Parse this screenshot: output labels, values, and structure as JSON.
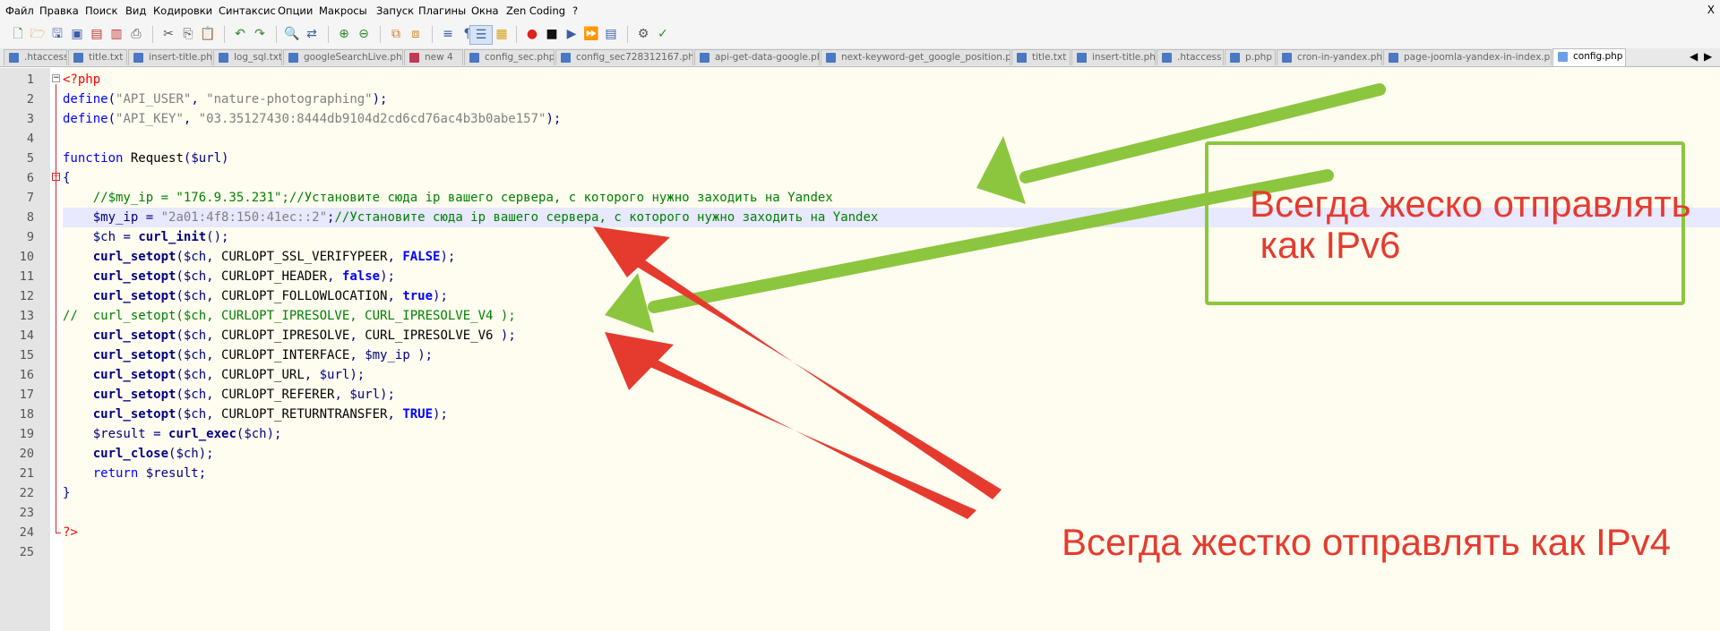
{
  "menu": [
    "Файл",
    "Правка",
    "Поиск",
    "Вид",
    "Кодировки",
    "Синтаксис",
    "Опции",
    "Макросы",
    "Запуск",
    "Плагины",
    "Окна",
    "Zen Coding",
    "?"
  ],
  "menu_close": "X",
  "tabs": [
    {
      "label": ".htaccess",
      "type": "normal"
    },
    {
      "label": "title.txt",
      "type": "normal"
    },
    {
      "label": "insert-title.php",
      "type": "normal"
    },
    {
      "label": "log_sql.txt",
      "type": "normal"
    },
    {
      "label": "googleSearchLive.php",
      "type": "normal"
    },
    {
      "label": "new 4",
      "type": "modified"
    },
    {
      "label": "config_sec.php",
      "type": "normal"
    },
    {
      "label": "config_sec728312167.php",
      "type": "normal"
    },
    {
      "label": "api-get-data-google.php",
      "type": "normal"
    },
    {
      "label": "next-keyword-get_google_position.php",
      "type": "normal"
    },
    {
      "label": "title.txt",
      "type": "normal"
    },
    {
      "label": "insert-title.php",
      "type": "normal"
    },
    {
      "label": ".htaccess",
      "type": "normal"
    },
    {
      "label": "p.php",
      "type": "normal"
    },
    {
      "label": "cron-in-yandex.php",
      "type": "normal"
    },
    {
      "label": "page-joomla-yandex-in-index.php",
      "type": "normal"
    },
    {
      "label": "config.php",
      "type": "active"
    }
  ],
  "tab_nav": {
    "prev": "◀",
    "next": "▶"
  },
  "line_numbers": [
    "1",
    "2",
    "3",
    "4",
    "5",
    "6",
    "7",
    "8",
    "9",
    "10",
    "11",
    "12",
    "13",
    "14",
    "15",
    "16",
    "17",
    "18",
    "19",
    "20",
    "21",
    "22",
    "23",
    "24",
    "25"
  ],
  "current_line": 8,
  "code_lines": [
    [
      [
        "tag",
        "<?php"
      ]
    ],
    [
      [
        "kw",
        "define"
      ],
      [
        "pn",
        "("
      ],
      [
        "str",
        "\"API_USER\""
      ],
      [
        "pn",
        ", "
      ],
      [
        "str",
        "\"nature-photographing\""
      ],
      [
        "pn",
        ");"
      ]
    ],
    [
      [
        "kw",
        "define"
      ],
      [
        "pn",
        "("
      ],
      [
        "str",
        "\"API_KEY\""
      ],
      [
        "pn",
        ", "
      ],
      [
        "str",
        "\"03.35127430:8444db9104d2cd6cd76ac4b3b0abe157\""
      ],
      [
        "pn",
        ");"
      ]
    ],
    [],
    [
      [
        "kw",
        "function"
      ],
      [
        "pl",
        " Request"
      ],
      [
        "pn",
        "("
      ],
      [
        "var",
        "$url"
      ],
      [
        "pn",
        ")"
      ]
    ],
    [
      [
        "pn",
        "{"
      ]
    ],
    [
      [
        "pl",
        "    "
      ],
      [
        "cm",
        "//$my_ip = \"176.9.35.231\";//Установите сюда ip вашего сервера, с которого нужно заходить на Yandex"
      ]
    ],
    [
      [
        "pl",
        "    "
      ],
      [
        "var",
        "$my_ip"
      ],
      [
        "pn",
        " = "
      ],
      [
        "str",
        "\"2a01:4f8:150:41ec::2\""
      ],
      [
        "pn",
        ";"
      ],
      [
        "cm",
        "//Установите сюда ip вашего сервера, с которого нужно заходить на Yandex"
      ]
    ],
    [
      [
        "pl",
        "    "
      ],
      [
        "var",
        "$ch"
      ],
      [
        "pn",
        " = "
      ],
      [
        "fn",
        "curl_init"
      ],
      [
        "pn",
        "();"
      ]
    ],
    [
      [
        "pl",
        "    "
      ],
      [
        "fn",
        "curl_setopt"
      ],
      [
        "pn",
        "("
      ],
      [
        "var",
        "$ch"
      ],
      [
        "pn",
        ", "
      ],
      [
        "pl",
        "CURLOPT_SSL_VERIFYPEER"
      ],
      [
        "pn",
        ", "
      ],
      [
        "bool",
        "FALSE"
      ],
      [
        "pn",
        ");"
      ]
    ],
    [
      [
        "pl",
        "    "
      ],
      [
        "fn",
        "curl_setopt"
      ],
      [
        "pn",
        "("
      ],
      [
        "var",
        "$ch"
      ],
      [
        "pn",
        ", "
      ],
      [
        "pl",
        "CURLOPT_HEADER"
      ],
      [
        "pn",
        ", "
      ],
      [
        "bool",
        "false"
      ],
      [
        "pn",
        ");"
      ]
    ],
    [
      [
        "pl",
        "    "
      ],
      [
        "fn",
        "curl_setopt"
      ],
      [
        "pn",
        "("
      ],
      [
        "var",
        "$ch"
      ],
      [
        "pn",
        ", "
      ],
      [
        "pl",
        "CURLOPT_FOLLOWLOCATION"
      ],
      [
        "pn",
        ", "
      ],
      [
        "bool",
        "true"
      ],
      [
        "pn",
        ");"
      ]
    ],
    [
      [
        "cm",
        "//  curl_setopt($ch, CURLOPT_IPRESOLVE, CURL_IPRESOLVE_V4 );"
      ]
    ],
    [
      [
        "pl",
        "    "
      ],
      [
        "fn",
        "curl_setopt"
      ],
      [
        "pn",
        "("
      ],
      [
        "var",
        "$ch"
      ],
      [
        "pn",
        ", "
      ],
      [
        "pl",
        "CURLOPT_IPRESOLVE"
      ],
      [
        "pn",
        ", "
      ],
      [
        "pl",
        "CURL_IPRESOLVE_V6"
      ],
      [
        "pn",
        " );"
      ]
    ],
    [
      [
        "pl",
        "    "
      ],
      [
        "fn",
        "curl_setopt"
      ],
      [
        "pn",
        "("
      ],
      [
        "var",
        "$ch"
      ],
      [
        "pn",
        ", "
      ],
      [
        "pl",
        "CURLOPT_INTERFACE"
      ],
      [
        "pn",
        ", "
      ],
      [
        "var",
        "$my_ip"
      ],
      [
        "pn",
        " );"
      ]
    ],
    [
      [
        "pl",
        "    "
      ],
      [
        "fn",
        "curl_setopt"
      ],
      [
        "pn",
        "("
      ],
      [
        "var",
        "$ch"
      ],
      [
        "pn",
        ", "
      ],
      [
        "pl",
        "CURLOPT_URL"
      ],
      [
        "pn",
        ", "
      ],
      [
        "var",
        "$url"
      ],
      [
        "pn",
        ");"
      ]
    ],
    [
      [
        "pl",
        "    "
      ],
      [
        "fn",
        "curl_setopt"
      ],
      [
        "pn",
        "("
      ],
      [
        "var",
        "$ch"
      ],
      [
        "pn",
        ", "
      ],
      [
        "pl",
        "CURLOPT_REFERER"
      ],
      [
        "pn",
        ", "
      ],
      [
        "var",
        "$url"
      ],
      [
        "pn",
        ");"
      ]
    ],
    [
      [
        "pl",
        "    "
      ],
      [
        "fn",
        "curl_setopt"
      ],
      [
        "pn",
        "("
      ],
      [
        "var",
        "$ch"
      ],
      [
        "pn",
        ", "
      ],
      [
        "pl",
        "CURLOPT_RETURNTRANSFER"
      ],
      [
        "pn",
        ", "
      ],
      [
        "bool",
        "TRUE"
      ],
      [
        "pn",
        ");"
      ]
    ],
    [
      [
        "pl",
        "    "
      ],
      [
        "var",
        "$result"
      ],
      [
        "pn",
        " = "
      ],
      [
        "fn",
        "curl_exec"
      ],
      [
        "pn",
        "("
      ],
      [
        "var",
        "$ch"
      ],
      [
        "pn",
        ");"
      ]
    ],
    [
      [
        "pl",
        "    "
      ],
      [
        "fn",
        "curl_close"
      ],
      [
        "pn",
        "("
      ],
      [
        "var",
        "$ch"
      ],
      [
        "pn",
        ");"
      ]
    ],
    [
      [
        "pl",
        "    "
      ],
      [
        "kw",
        "return"
      ],
      [
        "pl",
        " "
      ],
      [
        "var",
        "$result"
      ],
      [
        "pn",
        ";"
      ]
    ],
    [
      [
        "pn",
        "}"
      ]
    ],
    [],
    [
      [
        "tag",
        "?>"
      ]
    ],
    []
  ],
  "annotations": {
    "ipv6_text": "Всегда жеско отправлять\n как IPv6",
    "ipv4_text": "Всегда жестко отправлять как IPv4",
    "green": "#8cc63f",
    "red": "#e53b2f"
  }
}
